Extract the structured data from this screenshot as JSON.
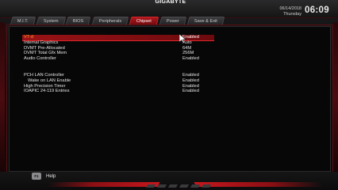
{
  "brand": "GIGABYTE",
  "tabs": [
    {
      "label": "M.I.T."
    },
    {
      "label": "System"
    },
    {
      "label": "BIOS"
    },
    {
      "label": "Peripherals"
    },
    {
      "label": "Chipset"
    },
    {
      "label": "Power"
    },
    {
      "label": "Save & Exit"
    }
  ],
  "active_tab": "Chipset",
  "datetime": {
    "date": "06/14/2018",
    "day": "Thursday",
    "time": "06:09"
  },
  "settings": [
    {
      "label": "VT-d",
      "value": "Enabled",
      "selected": true
    },
    {
      "label": "Internal Graphics",
      "value": "Auto"
    },
    {
      "label": "DVMT Pre-Allocated",
      "value": "64M"
    },
    {
      "label": "DVMT Total Gfx Mem",
      "value": "256M"
    },
    {
      "label": "Audio Controller",
      "value": "Enabled"
    },
    {
      "label": "PCH LAN Controller",
      "value": "Enabled"
    },
    {
      "label": "Wake on LAN Enable",
      "value": "Enabled",
      "indent": true
    },
    {
      "label": "High Precision Timer",
      "value": "Enabled"
    },
    {
      "label": "IOAPIC 24-119 Entries",
      "value": "Enabled"
    }
  ],
  "footer": {
    "help_key": "F1",
    "help_label": "Help"
  }
}
